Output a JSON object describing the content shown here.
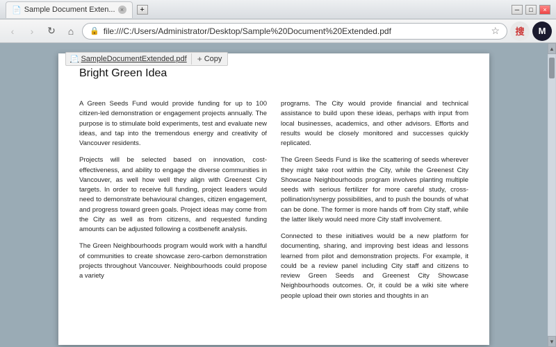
{
  "titlebar": {
    "tab_label": "Sample Document Exten...",
    "tab_close": "×",
    "controls": {
      "minimize": "─",
      "maximize": "□",
      "close": "×"
    }
  },
  "navbar": {
    "back": "‹",
    "forward": "›",
    "refresh": "↻",
    "home": "⌂",
    "url": "file:///C:/Users/Administrator/Desktop/Sample%20Document%20Extended.pdf",
    "star": "☆",
    "sogou": "搜",
    "m": "M"
  },
  "pdf": {
    "filename": "SampleDocumentExtended.pdf",
    "copy_label": "Copy",
    "copy_plus": "+",
    "title": "Bright Green Idea",
    "left_columns": [
      {
        "text": "A Green Seeds Fund would provide funding for up to 100 citizen-led demonstration or engagement projects annually. The purpose is to stimulate bold experiments, test and evaluate new ideas, and tap into the tremendous energy and creativity of Vancouver residents."
      },
      {
        "text": "Projects will be selected based on innovation, cost-effectiveness, and ability to engage the diverse communities in Vancouver, as well how well they align with Greenest City targets. In order to receive full funding, project leaders would need to demonstrate behavioural changes, citizen engagement, and progress toward green goals. Project ideas may come from the City as well as from citizens, and requested funding amounts can be adjusted following a costbenefit analysis."
      },
      {
        "text": "The Green Neighbourhoods program would work with a handful of communities to create showcase zero-carbon demonstration projects throughout Vancouver. Neighbourhoods could propose a variety"
      }
    ],
    "right_columns": [
      {
        "text": "programs. The City would provide financial and technical assistance to build upon these ideas, perhaps with input from local businesses, academics, and other advisors. Efforts and results would be closely monitored and successes quickly replicated."
      },
      {
        "text": "The Green Seeds Fund is like the scattering of seeds wherever they might take root within the City, while the Greenest City Showcase Neighbourhoods program involves planting multiple seeds with serious fertilizer for more careful study, cross-pollination/synergy possibilities, and to push the bounds of what can be done. The former is more hands off from City staff, while the latter likely would need more City staff involvement."
      },
      {
        "text": "Connected to these initiatives would be a new platform for documenting, sharing, and improving best ideas and lessons learned from pilot and demonstration projects. For example, it could be a review panel including City staff and citizens to review Green Seeds and Greenest City Showcase Neighbourhoods outcomes. Or, it could be a wiki site where people upload their own stories and thoughts in an"
      }
    ]
  }
}
